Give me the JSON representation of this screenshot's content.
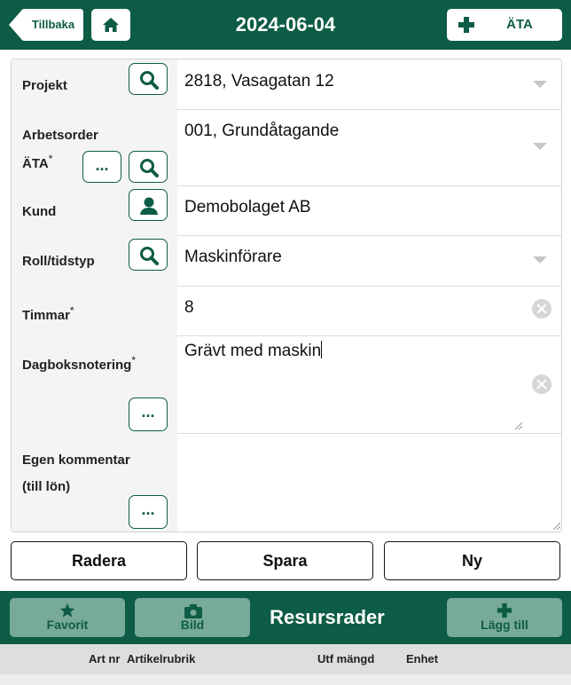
{
  "header": {
    "back_label": "Tillbaka",
    "date": "2024-06-04",
    "ata_label": "ÄTA"
  },
  "form": {
    "projekt": {
      "label": "Projekt",
      "value": "2818, Vasagatan 12"
    },
    "arbetsorder": {
      "label_line1": "Arbetsorder",
      "label_line2": "ÄTA",
      "required_mark": "*",
      "value": "001, Grundåtagande",
      "more_label": "..."
    },
    "kund": {
      "label": "Kund",
      "value": "Demobolaget AB"
    },
    "roll": {
      "label": "Roll/tidstyp",
      "value": "Maskinförare"
    },
    "timmar": {
      "label": "Timmar",
      "required_mark": "*",
      "value": "8"
    },
    "dagbok": {
      "label": "Dagboksnotering",
      "required_mark": "*",
      "value": "Grävt med maskin",
      "more_label": "..."
    },
    "kommentar": {
      "label_line1": "Egen kommentar",
      "label_line2": "(till lön)",
      "value": "",
      "more_label": "..."
    }
  },
  "actions": {
    "delete_label": "Radera",
    "save_label": "Spara",
    "new_label": "Ny"
  },
  "resources": {
    "favorite_label": "Favorit",
    "image_label": "Bild",
    "title": "Resursrader",
    "add_label": "Lägg till",
    "columns": [
      "Art nr",
      "Artikelrubrik",
      "Utf mängd",
      "Enhet"
    ]
  },
  "colors": {
    "brand_green": "#0d5c45",
    "button_muted": "#78aa99"
  },
  "icons": [
    "back-arrow-icon",
    "home-icon",
    "plus-icon",
    "search-icon",
    "person-icon",
    "star-icon",
    "camera-icon",
    "clear-icon",
    "dropdown-caret-icon"
  ]
}
